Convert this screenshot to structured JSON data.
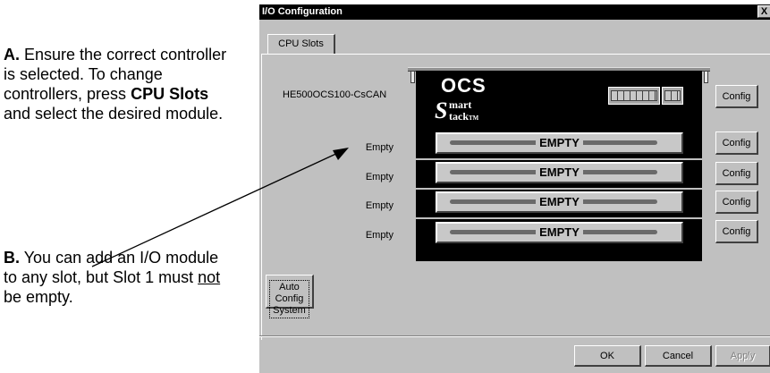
{
  "annotations": {
    "a": {
      "letter": "A.",
      "text1": "Ensure the correct controller is selected. To change controllers, press",
      "bold": "CPU Slots",
      "text2": "and select the desired module."
    },
    "b": {
      "letter": "B.",
      "text1": "You can add an I/O module to any slot, but Slot 1 must",
      "underline": "not",
      "text2": "be empty."
    }
  },
  "dialog": {
    "title": "I/O Configuration",
    "close_label": "X",
    "tab": "CPU Slots",
    "controller": {
      "name": "HE500OCS100-CsCAN",
      "brand": "OCS",
      "logo_s1": "S",
      "logo_w1": "mart",
      "logo_s2": "S",
      "logo_w2": "tack",
      "logo_tm": "TM",
      "config_label": "Config"
    },
    "slots": [
      {
        "label": "Empty",
        "card": "EMPTY",
        "config_label": "Config"
      },
      {
        "label": "Empty",
        "card": "EMPTY",
        "config_label": "Config"
      },
      {
        "label": "Empty",
        "card": "EMPTY",
        "config_label": "Config"
      },
      {
        "label": "Empty",
        "card": "EMPTY",
        "config_label": "Config"
      }
    ],
    "auto_config_line1": "Auto Config",
    "auto_config_line2": "System",
    "ok_label": "OK",
    "cancel_label": "Cancel",
    "apply_label": "Apply"
  }
}
